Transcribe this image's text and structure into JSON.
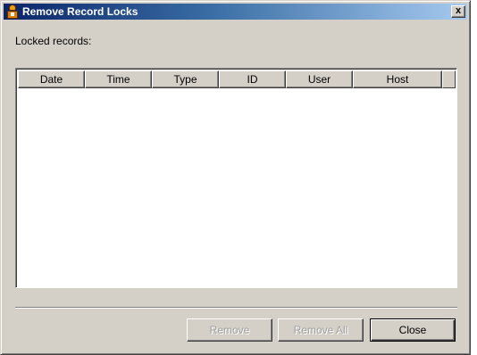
{
  "window": {
    "title": "Remove Record Locks",
    "close_glyph": "x"
  },
  "labels": {
    "locked_records": "Locked records:"
  },
  "table": {
    "columns": [
      "Date",
      "Time",
      "Type",
      "ID",
      "User",
      "Host"
    ],
    "rows": []
  },
  "buttons": {
    "remove": "Remove",
    "remove_all": "Remove All",
    "close": "Close"
  },
  "icons": {
    "title": "user-lock-icon"
  },
  "colors": {
    "title_bar_start": "#0a246a",
    "title_bar_end": "#a6caf0",
    "dialog_face": "#d4d0c8",
    "disabled_text": "#a0a0a0"
  }
}
